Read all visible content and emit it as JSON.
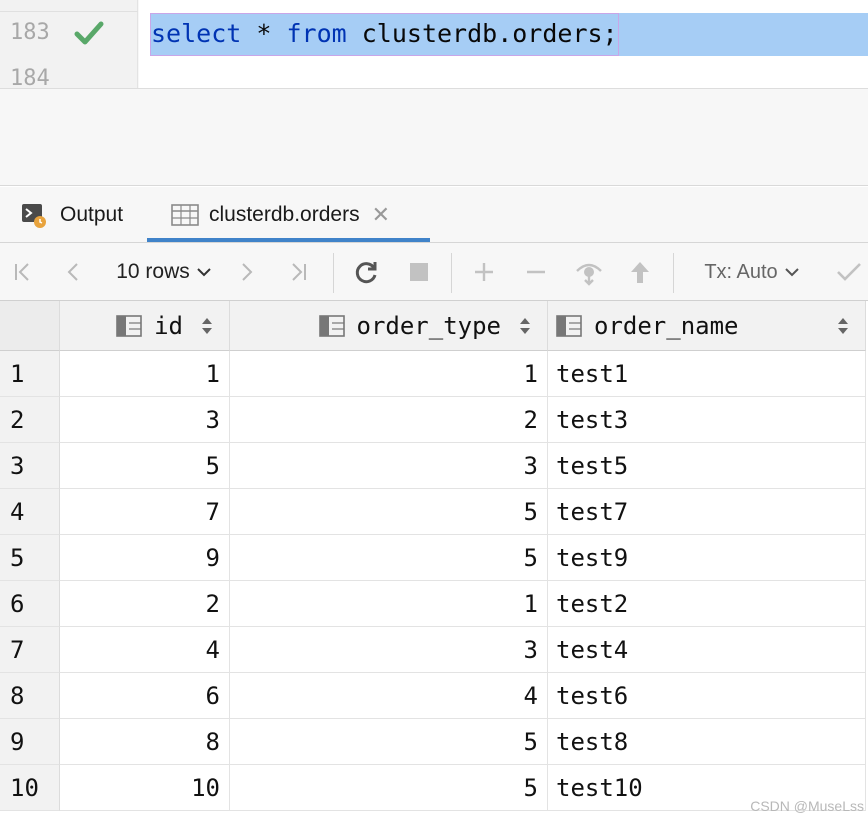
{
  "editor": {
    "line_numbers": [
      "183",
      "184"
    ],
    "code": {
      "kw_select": "select",
      "op_star": " * ",
      "kw_from": "from",
      "rest": " clusterdb.orders;"
    }
  },
  "tabs": {
    "output_label": "Output",
    "orders_label": "clusterdb.orders",
    "close_glyph": "✕"
  },
  "toolbar": {
    "rows_label": "10 rows",
    "tx_label": "Tx: Auto"
  },
  "grid": {
    "columns": [
      "id",
      "order_type",
      "order_name"
    ],
    "rows": [
      {
        "n": "1",
        "id": "1",
        "type": "1",
        "name": "test1"
      },
      {
        "n": "2",
        "id": "3",
        "type": "2",
        "name": "test3"
      },
      {
        "n": "3",
        "id": "5",
        "type": "3",
        "name": "test5"
      },
      {
        "n": "4",
        "id": "7",
        "type": "5",
        "name": "test7"
      },
      {
        "n": "5",
        "id": "9",
        "type": "5",
        "name": "test9"
      },
      {
        "n": "6",
        "id": "2",
        "type": "1",
        "name": "test2"
      },
      {
        "n": "7",
        "id": "4",
        "type": "3",
        "name": "test4"
      },
      {
        "n": "8",
        "id": "6",
        "type": "4",
        "name": "test6"
      },
      {
        "n": "9",
        "id": "8",
        "type": "5",
        "name": "test8"
      },
      {
        "n": "10",
        "id": "10",
        "type": "5",
        "name": "test10"
      }
    ]
  },
  "watermark": "CSDN @MuseLss",
  "colors": {
    "keyword": "#0033b3",
    "line_highlight": "#a6cdf5",
    "success_check": "#59a869",
    "tab_underline": "#4083c9"
  }
}
